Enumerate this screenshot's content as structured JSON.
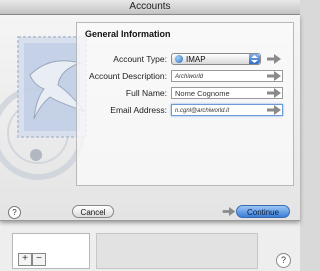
{
  "window": {
    "title": "Accounts"
  },
  "form": {
    "section_title": "General Information",
    "fields": [
      {
        "label": "Account Type:",
        "value": "IMAP"
      },
      {
        "label": "Account Description:",
        "value": "Archiworld"
      },
      {
        "label": "Full Name:",
        "value": "Nome Cognome"
      },
      {
        "label": "Email Address:",
        "value": "n.cgnl@archiworld.it"
      }
    ]
  },
  "buttons": {
    "help": "?",
    "cancel": "Cancel",
    "continue": "Continue"
  },
  "background": {
    "add": "+",
    "remove": "−",
    "help": "?"
  },
  "colors": {
    "accent": "#3b7ed8",
    "arrow": "#8a8a8a",
    "stamp": "#d3dbe8"
  }
}
